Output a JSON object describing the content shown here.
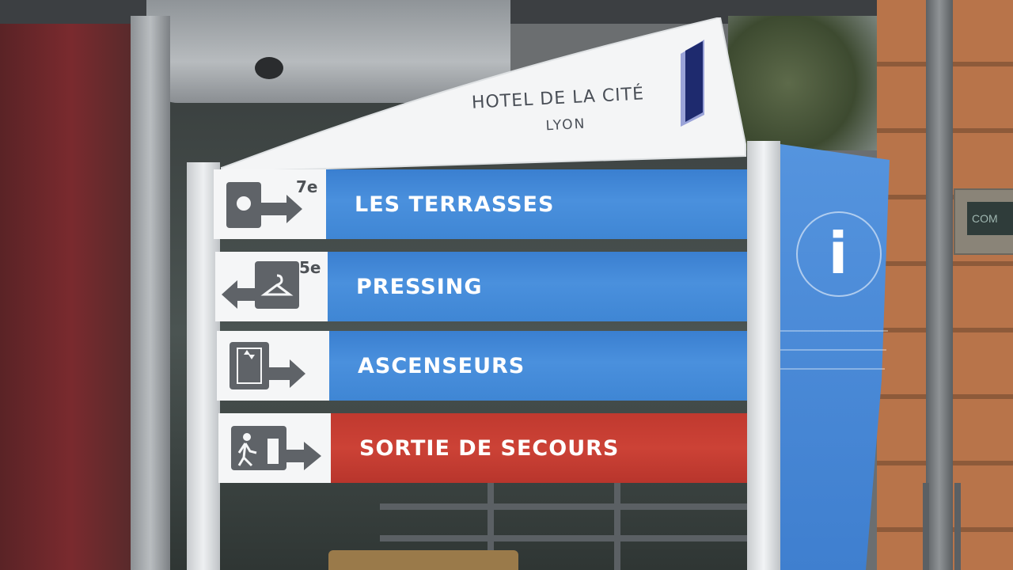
{
  "sign": {
    "hotel_name": "HOTEL DE LA CITÉ",
    "city": "LYON",
    "info_symbol": "i",
    "rows": [
      {
        "floor": "7e",
        "label": "LES TERRASSES",
        "icon": "keycard-arrow-right-icon",
        "color": "#3f86d4"
      },
      {
        "floor": "5e",
        "label": "PRESSING",
        "icon": "hanger-arrow-left-icon",
        "color": "#3f86d4"
      },
      {
        "floor": "",
        "label": "ASCENSEURS",
        "icon": "elevator-arrow-right-icon",
        "color": "#3f86d4"
      },
      {
        "floor": "",
        "label": "SORTIE DE SECOURS",
        "icon": "emergency-exit-arrow-right-icon",
        "color": "#c0392f"
      }
    ]
  },
  "plaque": {
    "text": "COM"
  },
  "colors": {
    "sign_blue": "#3f86d4",
    "sign_red": "#c0392f",
    "brand_navy": "#1e2a6e",
    "brick": "#b8744a"
  }
}
